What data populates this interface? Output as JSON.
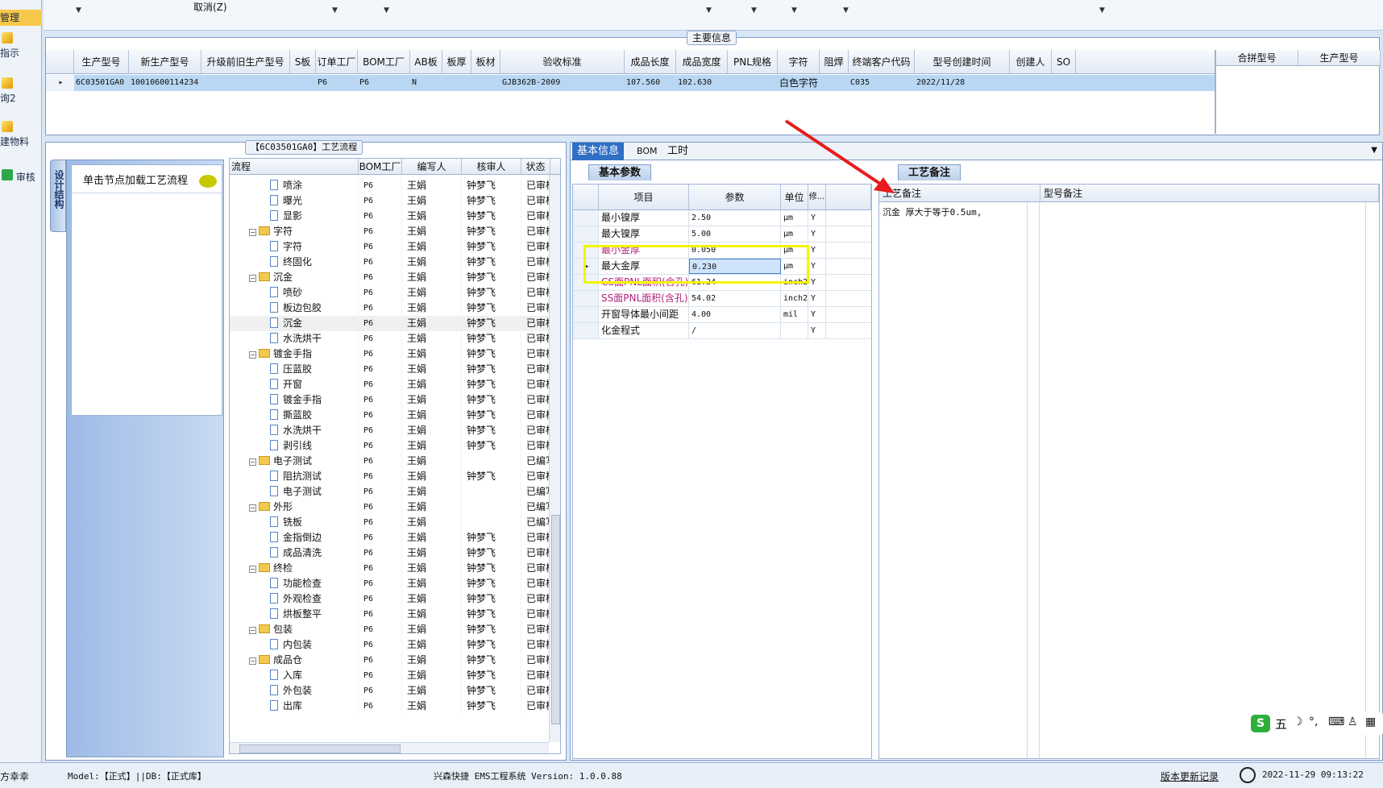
{
  "nav": {
    "items": [
      {
        "label": "管理"
      },
      {
        "label": "指示"
      },
      {
        "label": "询2"
      },
      {
        "label": "建物料"
      },
      {
        "label": "审核"
      }
    ]
  },
  "topstrip": {
    "cancel_label": "取消(Z)"
  },
  "main_info": {
    "caption": "主要信息",
    "columns": [
      "生产型号",
      "新生产型号",
      "升级前旧生产型号",
      "S板",
      "订单工厂",
      "BOM工厂",
      "AB板",
      "板厚",
      "板材",
      "验收标准",
      "成品长度",
      "成品宽度",
      "PNL规格",
      "字符",
      "阻焊",
      "终端客户代码",
      "型号创建时间",
      "创建人",
      "SO"
    ],
    "row": [
      "6C03501GA0",
      "10010600114234",
      "",
      "",
      "P6",
      "P6",
      "N",
      "",
      "",
      "GJB362B-2009",
      "107.560",
      "102.630",
      "",
      "白色字符",
      "",
      "C035",
      "2022/11/28",
      "",
      ""
    ],
    "side_columns": [
      "合拼型号",
      "生产型号"
    ]
  },
  "process": {
    "caption": "【6C03501GA0】工艺流程",
    "side_tab": "设计结构",
    "load_hint": "单击节点加载工艺流程",
    "columns": [
      "流程",
      "BOM工厂",
      "编写人",
      "核审人",
      "状态"
    ],
    "rows": [
      {
        "level": 2,
        "type": "doc",
        "name": "喷涂",
        "bom": "P6",
        "writer": "王娟",
        "reviewer": "钟梦飞",
        "status": "已审核"
      },
      {
        "level": 2,
        "type": "doc",
        "name": "曝光",
        "bom": "P6",
        "writer": "王娟",
        "reviewer": "钟梦飞",
        "status": "已审核"
      },
      {
        "level": 2,
        "type": "doc",
        "name": "显影",
        "bom": "P6",
        "writer": "王娟",
        "reviewer": "钟梦飞",
        "status": "已审核"
      },
      {
        "level": 1,
        "type": "folder",
        "name": "字符",
        "bom": "P6",
        "writer": "王娟",
        "reviewer": "钟梦飞",
        "status": "已审核"
      },
      {
        "level": 2,
        "type": "doc",
        "name": "字符",
        "bom": "P6",
        "writer": "王娟",
        "reviewer": "钟梦飞",
        "status": "已审核"
      },
      {
        "level": 2,
        "type": "doc",
        "name": "终固化",
        "bom": "P6",
        "writer": "王娟",
        "reviewer": "钟梦飞",
        "status": "已审核"
      },
      {
        "level": 1,
        "type": "folder",
        "name": "沉金",
        "bom": "P6",
        "writer": "王娟",
        "reviewer": "钟梦飞",
        "status": "已审核"
      },
      {
        "level": 2,
        "type": "doc",
        "name": "喷砂",
        "bom": "P6",
        "writer": "王娟",
        "reviewer": "钟梦飞",
        "status": "已审核"
      },
      {
        "level": 2,
        "type": "doc",
        "name": "板边包胶",
        "bom": "P6",
        "writer": "王娟",
        "reviewer": "钟梦飞",
        "status": "已审核"
      },
      {
        "level": 2,
        "type": "doc",
        "name": "沉金",
        "bom": "P6",
        "writer": "王娟",
        "reviewer": "钟梦飞",
        "status": "已审核",
        "selected": true
      },
      {
        "level": 2,
        "type": "doc",
        "name": "水洗烘干",
        "bom": "P6",
        "writer": "王娟",
        "reviewer": "钟梦飞",
        "status": "已审核"
      },
      {
        "level": 1,
        "type": "folder",
        "name": "镀金手指",
        "bom": "P6",
        "writer": "王娟",
        "reviewer": "钟梦飞",
        "status": "已审核"
      },
      {
        "level": 2,
        "type": "doc",
        "name": "压蓝胶",
        "bom": "P6",
        "writer": "王娟",
        "reviewer": "钟梦飞",
        "status": "已审核"
      },
      {
        "level": 2,
        "type": "doc",
        "name": "开窗",
        "bom": "P6",
        "writer": "王娟",
        "reviewer": "钟梦飞",
        "status": "已审核"
      },
      {
        "level": 2,
        "type": "doc",
        "name": "镀金手指",
        "bom": "P6",
        "writer": "王娟",
        "reviewer": "钟梦飞",
        "status": "已审核"
      },
      {
        "level": 2,
        "type": "doc",
        "name": "撕蓝胶",
        "bom": "P6",
        "writer": "王娟",
        "reviewer": "钟梦飞",
        "status": "已审核"
      },
      {
        "level": 2,
        "type": "doc",
        "name": "水洗烘干",
        "bom": "P6",
        "writer": "王娟",
        "reviewer": "钟梦飞",
        "status": "已审核"
      },
      {
        "level": 2,
        "type": "doc",
        "name": "剥引线",
        "bom": "P6",
        "writer": "王娟",
        "reviewer": "钟梦飞",
        "status": "已审核"
      },
      {
        "level": 1,
        "type": "folder",
        "name": "电子测试",
        "bom": "P6",
        "writer": "王娟",
        "reviewer": "",
        "status": "已编写"
      },
      {
        "level": 2,
        "type": "doc",
        "name": "阻抗测试",
        "bom": "P6",
        "writer": "王娟",
        "reviewer": "钟梦飞",
        "status": "已审核"
      },
      {
        "level": 2,
        "type": "doc",
        "name": "电子测试",
        "bom": "P6",
        "writer": "王娟",
        "reviewer": "",
        "status": "已编写"
      },
      {
        "level": 1,
        "type": "folder",
        "name": "外形",
        "bom": "P6",
        "writer": "王娟",
        "reviewer": "",
        "status": "已编写"
      },
      {
        "level": 2,
        "type": "doc",
        "name": "铣板",
        "bom": "P6",
        "writer": "王娟",
        "reviewer": "",
        "status": "已编写"
      },
      {
        "level": 2,
        "type": "doc",
        "name": "金指倒边",
        "bom": "P6",
        "writer": "王娟",
        "reviewer": "钟梦飞",
        "status": "已审核"
      },
      {
        "level": 2,
        "type": "doc",
        "name": "成品清洗",
        "bom": "P6",
        "writer": "王娟",
        "reviewer": "钟梦飞",
        "status": "已审核"
      },
      {
        "level": 1,
        "type": "folder",
        "name": "终检",
        "bom": "P6",
        "writer": "王娟",
        "reviewer": "钟梦飞",
        "status": "已审核"
      },
      {
        "level": 2,
        "type": "doc",
        "name": "功能检查",
        "bom": "P6",
        "writer": "王娟",
        "reviewer": "钟梦飞",
        "status": "已审核"
      },
      {
        "level": 2,
        "type": "doc",
        "name": "外观检查",
        "bom": "P6",
        "writer": "王娟",
        "reviewer": "钟梦飞",
        "status": "已审核"
      },
      {
        "level": 2,
        "type": "doc",
        "name": "烘板整平",
        "bom": "P6",
        "writer": "王娟",
        "reviewer": "钟梦飞",
        "status": "已审核"
      },
      {
        "level": 1,
        "type": "folder",
        "name": "包装",
        "bom": "P6",
        "writer": "王娟",
        "reviewer": "钟梦飞",
        "status": "已审核"
      },
      {
        "level": 2,
        "type": "doc",
        "name": "内包装",
        "bom": "P6",
        "writer": "王娟",
        "reviewer": "钟梦飞",
        "status": "已审核"
      },
      {
        "level": 1,
        "type": "folder",
        "name": "成品仓",
        "bom": "P6",
        "writer": "王娟",
        "reviewer": "钟梦飞",
        "status": "已审核"
      },
      {
        "level": 2,
        "type": "doc",
        "name": "入库",
        "bom": "P6",
        "writer": "王娟",
        "reviewer": "钟梦飞",
        "status": "已审核"
      },
      {
        "level": 2,
        "type": "doc",
        "name": "外包装",
        "bom": "P6",
        "writer": "王娟",
        "reviewer": "钟梦飞",
        "status": "已审核"
      },
      {
        "level": 2,
        "type": "doc",
        "name": "出库",
        "bom": "P6",
        "writer": "王娟",
        "reviewer": "钟梦飞",
        "status": "已审核"
      }
    ]
  },
  "detail": {
    "tabs": [
      "基本信息",
      "BOM",
      "工时"
    ],
    "subtab_params": "基本参数",
    "subtab_notes": "工艺备注",
    "param_columns": [
      "项目",
      "参数",
      "单位",
      "修..."
    ],
    "params": [
      {
        "item": "最小镍厚",
        "value": "2.50",
        "unit": "μm",
        "mod": "Y",
        "highlight": false
      },
      {
        "item": "最大镍厚",
        "value": "5.00",
        "unit": "μm",
        "mod": "Y",
        "highlight": false
      },
      {
        "item": "最小金厚",
        "value": "0.050",
        "unit": "μm",
        "mod": "Y",
        "highlight": true
      },
      {
        "item": "最大金厚",
        "value": "0.230",
        "unit": "μm",
        "mod": "Y",
        "highlight": false,
        "current": true
      },
      {
        "item": "CS面PNL面积(含孔)",
        "value": "61.24",
        "unit": "inch2",
        "mod": "Y",
        "highlight": true
      },
      {
        "item": "SS面PNL面积(含孔)",
        "value": "54.02",
        "unit": "inch2",
        "mod": "Y",
        "highlight": true
      },
      {
        "item": "开窗导体最小间距",
        "value": "4.00",
        "unit": "mil",
        "mod": "Y",
        "highlight": false
      },
      {
        "item": "化金程式",
        "value": "/",
        "unit": "",
        "mod": "Y",
        "highlight": false
      }
    ],
    "note_columns": [
      "工艺备注",
      "型号备注"
    ],
    "note_text": "沉金 厚大于等于0.5um,"
  },
  "ime": {
    "label": "五"
  },
  "statusbar": {
    "user": "方幸幸",
    "model_db": "Model:【正式】||DB:【正式库】",
    "system": "兴森快捷 EMS工程系统 Version: 1.0.0.88",
    "update_log": "版本更新记录",
    "datetime": "2022-11-29 09:13:22"
  },
  "colors": {
    "selected_row": "#b9d7f3",
    "highlight_box": "#f4f400",
    "annotation_arrow": "#e81c1c",
    "tab_active": "#2f6fc4"
  }
}
